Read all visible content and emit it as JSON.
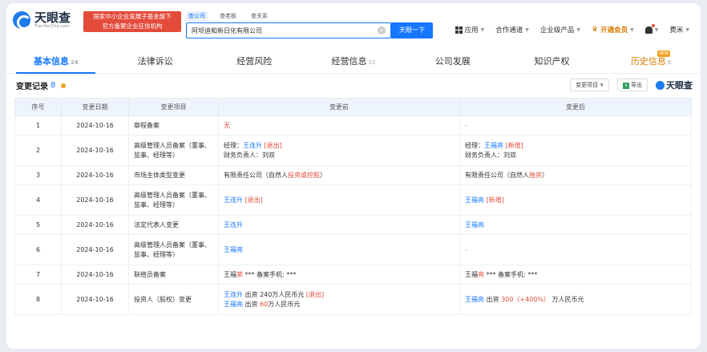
{
  "header": {
    "logo_name": "天眼查",
    "logo_sub": "TianYanCha.com",
    "badge_line1": "国家中小企业发展子基金旗下",
    "badge_line2": "官方备案企业征信机构",
    "search_tabs": [
      "查公司",
      "查老板",
      "查关系"
    ],
    "search_value": "阿坝迪和新日化有限公司",
    "search_button": "天眼一下",
    "nav": {
      "apps": "应用",
      "cooperation": "合作通道",
      "enterprise": "企业级产品",
      "vip": "开通会员",
      "user": "费米"
    }
  },
  "tabs": [
    {
      "label": "基本信息",
      "count": "24"
    },
    {
      "label": "法律诉讼",
      "count": ""
    },
    {
      "label": "经营风险",
      "count": ""
    },
    {
      "label": "经营信息",
      "count": "10"
    },
    {
      "label": "公司发展",
      "count": ""
    },
    {
      "label": "知识产权",
      "count": ""
    },
    {
      "label": "历史信息",
      "count": "6"
    }
  ],
  "history_badge": "NEW",
  "section": {
    "title": "变更记录",
    "count": "8",
    "filter_button": "变更项目",
    "export_button": "导出",
    "brand": "天眼查"
  },
  "table": {
    "headers": [
      "序号",
      "变更日期",
      "变更项目",
      "变更前",
      "变更后"
    ],
    "rows": [
      {
        "no": "1",
        "date": "2024-10-16",
        "item": "章程备案",
        "before": [
          [
            "无",
            "red"
          ]
        ],
        "after": [
          [
            "-",
            "dash"
          ]
        ]
      },
      {
        "no": "2",
        "date": "2024-10-16",
        "item": "高级管理人员备案（董事、监事、经理等）",
        "before": [
          [
            "经理：",
            ""
          ],
          [
            "王连升",
            "blue"
          ],
          [
            " [退出]",
            "red"
          ],
          [
            "\n财务负责人：刘双",
            ""
          ]
        ],
        "after": [
          [
            "经理：",
            ""
          ],
          [
            "王福亮",
            "blue"
          ],
          [
            " [新增]",
            "red"
          ],
          [
            "\n财务负责人：刘双",
            ""
          ]
        ]
      },
      {
        "no": "3",
        "date": "2024-10-16",
        "item": "市场主体类型变更",
        "before": [
          [
            "有限责任公司（自然人",
            ""
          ],
          [
            "投资或控股",
            "red"
          ],
          [
            "）",
            ""
          ]
        ],
        "after": [
          [
            "有限责任公司（自然人",
            ""
          ],
          [
            "独资",
            "red"
          ],
          [
            "）",
            ""
          ]
        ]
      },
      {
        "no": "4",
        "date": "2024-10-16",
        "item": "高级管理人员备案（董事、监事、经理等）",
        "before": [
          [
            "王连升",
            "blue"
          ],
          [
            " [退出]",
            "red"
          ]
        ],
        "after": [
          [
            "王福亮",
            "blue"
          ],
          [
            " [新增]",
            "red"
          ]
        ]
      },
      {
        "no": "5",
        "date": "2024-10-16",
        "item": "法定代表人变更",
        "before": [
          [
            "王连升",
            "blue"
          ]
        ],
        "after": [
          [
            "王福亮",
            "blue"
          ]
        ]
      },
      {
        "no": "6",
        "date": "2024-10-16",
        "item": "高级管理人员备案（董事、监事、经理等）",
        "before": [
          [
            "王福亮",
            "blue"
          ]
        ],
        "after": [
          [
            "-",
            "dash"
          ]
        ]
      },
      {
        "no": "7",
        "date": "2024-10-16",
        "item": "联络员备案",
        "before": [
          [
            "王福",
            ""
          ],
          [
            "荣",
            "red"
          ],
          [
            " *** 备案手机: ***",
            ""
          ]
        ],
        "after": [
          [
            "王福",
            ""
          ],
          [
            "亮",
            "red"
          ],
          [
            " *** 备案手机: ***",
            ""
          ]
        ]
      },
      {
        "no": "8",
        "date": "2024-10-16",
        "item": "投资人（股权）变更",
        "before": [
          [
            "王连升",
            "blue"
          ],
          [
            " 出资 240万人民币元 ",
            ""
          ],
          [
            "[退出]",
            "red"
          ],
          [
            "\n",
            ""
          ],
          [
            "王福亮",
            "blue"
          ],
          [
            " 出资 ",
            ""
          ],
          [
            "60",
            "red"
          ],
          [
            "万人民币元",
            ""
          ]
        ],
        "after": [
          [
            "王福亮",
            "blue"
          ],
          [
            " 出资 ",
            ""
          ],
          [
            "300（+400%）",
            "red"
          ],
          [
            " 万人民币元",
            ""
          ]
        ]
      }
    ]
  },
  "colors": {
    "accent": "#1677ff",
    "red": "#e34b3b",
    "vip": "#d97a00"
  }
}
